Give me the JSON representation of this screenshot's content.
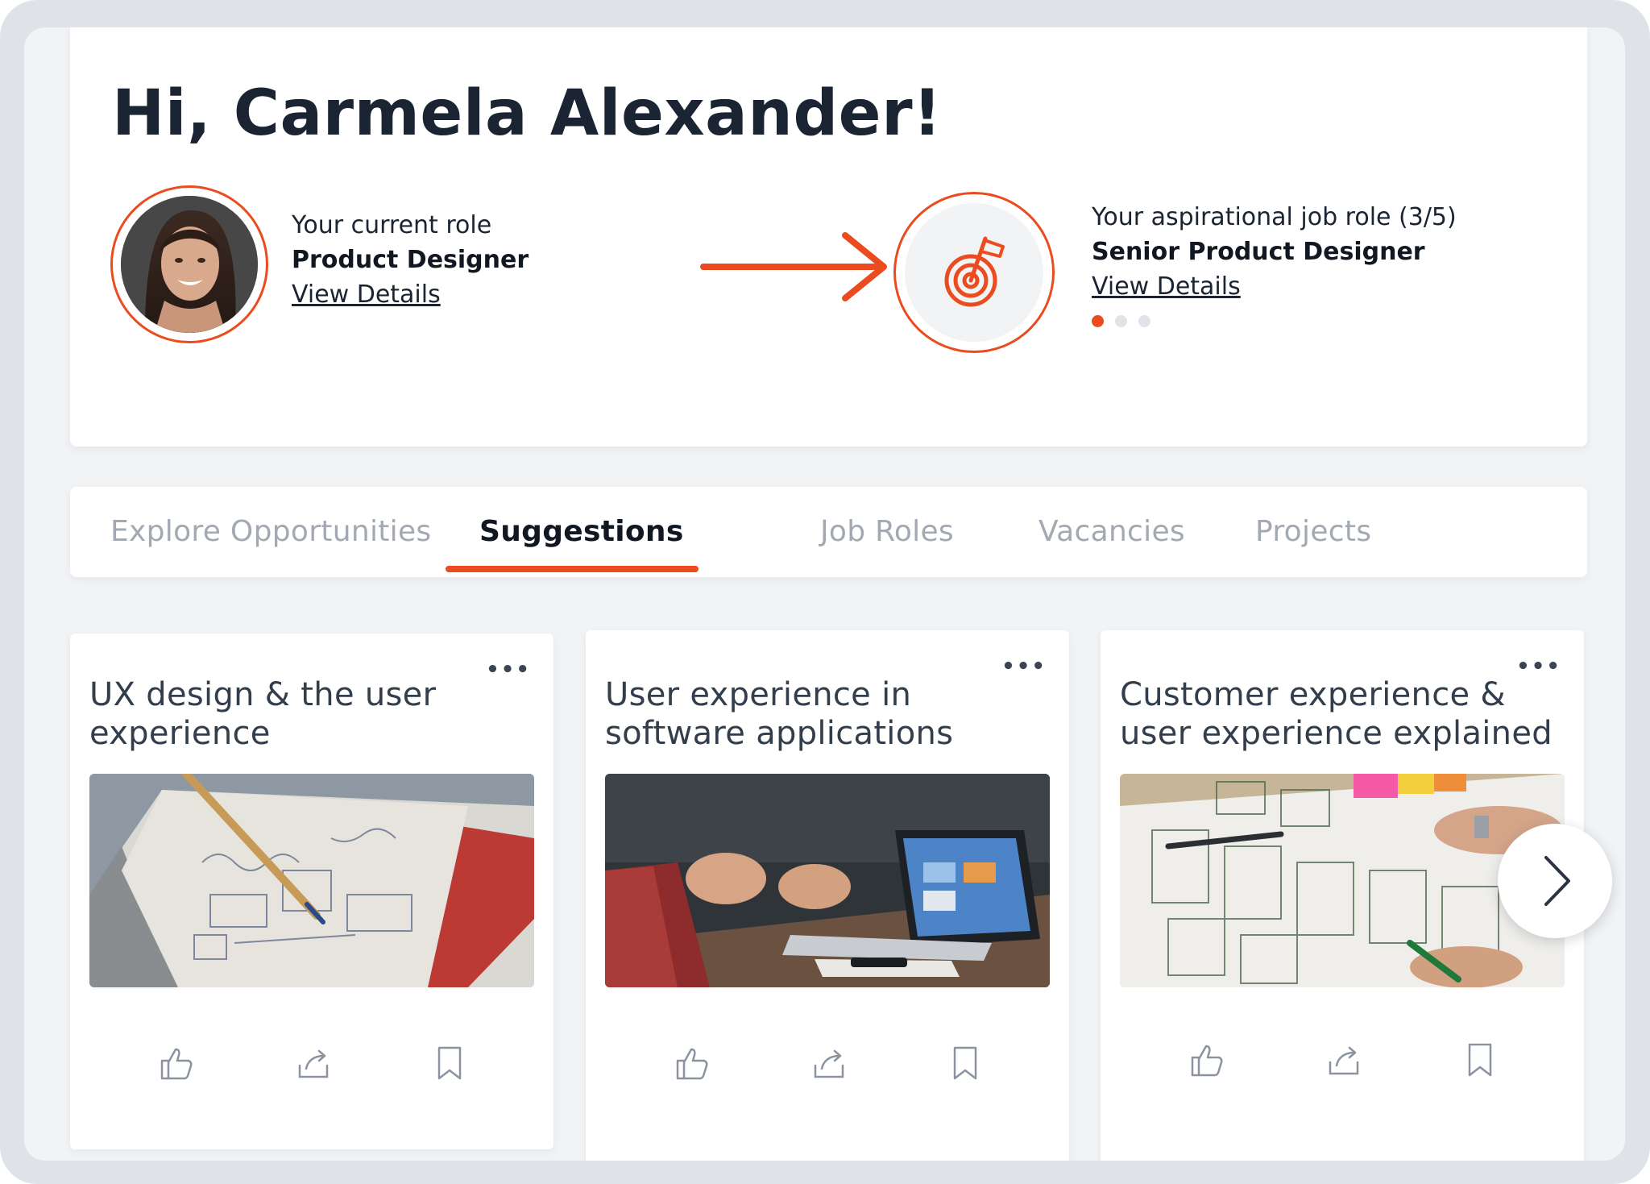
{
  "greeting": "Hi, Carmela Alexander!",
  "current_role": {
    "label": "Your current role",
    "title": "Product Designer",
    "link": "View Details"
  },
  "aspirational_role": {
    "label": "Your aspirational job role (3/5)",
    "title": "Senior Product Designer",
    "link": "View Details",
    "dots_total": 3,
    "dots_active_index": 0
  },
  "tabs": [
    {
      "label": "Explore Opportunities",
      "active": false
    },
    {
      "label": "Suggestions",
      "active": true
    },
    {
      "label": "Job Roles",
      "active": false
    },
    {
      "label": "Vacancies",
      "active": false
    },
    {
      "label": "Projects",
      "active": false
    }
  ],
  "cards": [
    {
      "title": "UX design & the user experience",
      "more": "•••",
      "image": "notebook-sketch-photo"
    },
    {
      "title": "User experience in software applications",
      "more": "•••",
      "image": "laptop-meeting-photo"
    },
    {
      "title": "Customer experience & user experience explained",
      "more": "•••",
      "image": "wireframe-sketches-photo"
    }
  ],
  "card_actions": [
    "thumbs-up-icon",
    "share-icon",
    "bookmark-icon"
  ],
  "icons": {
    "arrow": "arrow-right-icon",
    "target": "target-flag-icon",
    "next": "chevron-right-icon"
  },
  "colors": {
    "accent": "#ea4b1f",
    "text_dark": "#1b2432",
    "tab_inactive": "#a3a9b2",
    "background": "#f1f3f5"
  }
}
